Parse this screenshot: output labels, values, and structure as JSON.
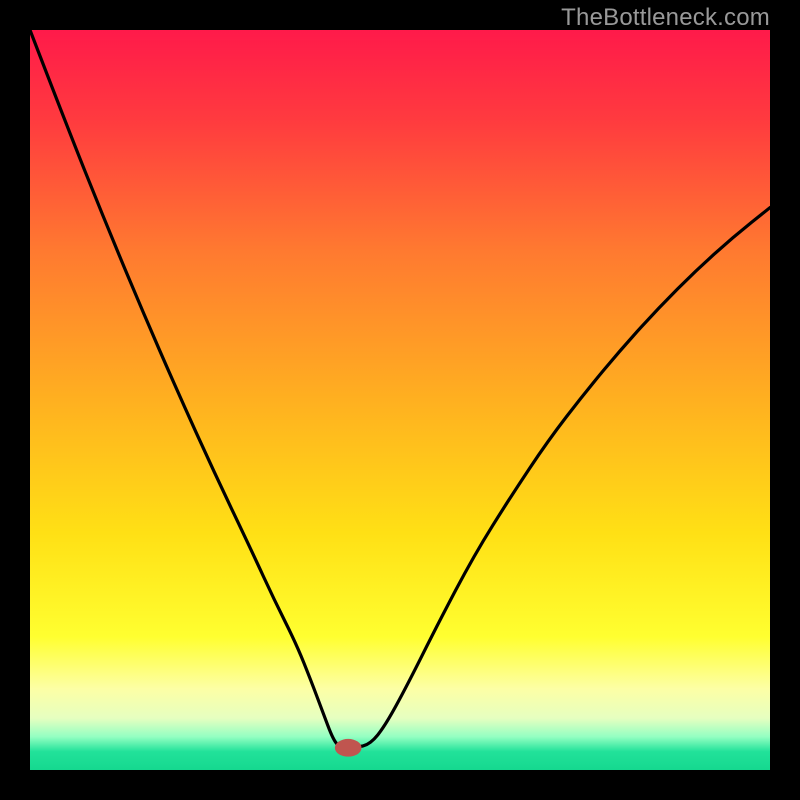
{
  "watermark": "TheBottleneck.com",
  "chart_data": {
    "type": "line",
    "title": "",
    "xlabel": "",
    "ylabel": "",
    "xlim": [
      0,
      1
    ],
    "ylim": [
      0,
      1
    ],
    "gradient_stops": [
      {
        "offset": 0.0,
        "color": "#ff1a4a"
      },
      {
        "offset": 0.12,
        "color": "#ff3a3f"
      },
      {
        "offset": 0.3,
        "color": "#ff7a30"
      },
      {
        "offset": 0.5,
        "color": "#ffb020"
      },
      {
        "offset": 0.68,
        "color": "#ffe015"
      },
      {
        "offset": 0.82,
        "color": "#ffff30"
      },
      {
        "offset": 0.89,
        "color": "#fdffa5"
      },
      {
        "offset": 0.93,
        "color": "#e6ffc0"
      },
      {
        "offset": 0.955,
        "color": "#94ffc2"
      },
      {
        "offset": 0.975,
        "color": "#22e29a"
      },
      {
        "offset": 1.0,
        "color": "#15d88f"
      }
    ],
    "series": [
      {
        "name": "bottleneck-curve",
        "x": [
          0.0,
          0.05,
          0.1,
          0.15,
          0.2,
          0.25,
          0.3,
          0.33,
          0.36,
          0.38,
          0.395,
          0.41,
          0.42,
          0.44,
          0.46,
          0.48,
          0.51,
          0.55,
          0.6,
          0.65,
          0.7,
          0.75,
          0.8,
          0.85,
          0.9,
          0.95,
          1.0
        ],
        "y": [
          1.0,
          0.87,
          0.745,
          0.625,
          0.51,
          0.4,
          0.295,
          0.23,
          0.17,
          0.12,
          0.08,
          0.04,
          0.03,
          0.03,
          0.035,
          0.06,
          0.115,
          0.195,
          0.29,
          0.37,
          0.445,
          0.51,
          0.57,
          0.625,
          0.675,
          0.72,
          0.76
        ]
      }
    ],
    "marker": {
      "x": 0.43,
      "y": 0.03,
      "color": "#c0554f",
      "rx": 0.018,
      "ry": 0.012
    }
  }
}
